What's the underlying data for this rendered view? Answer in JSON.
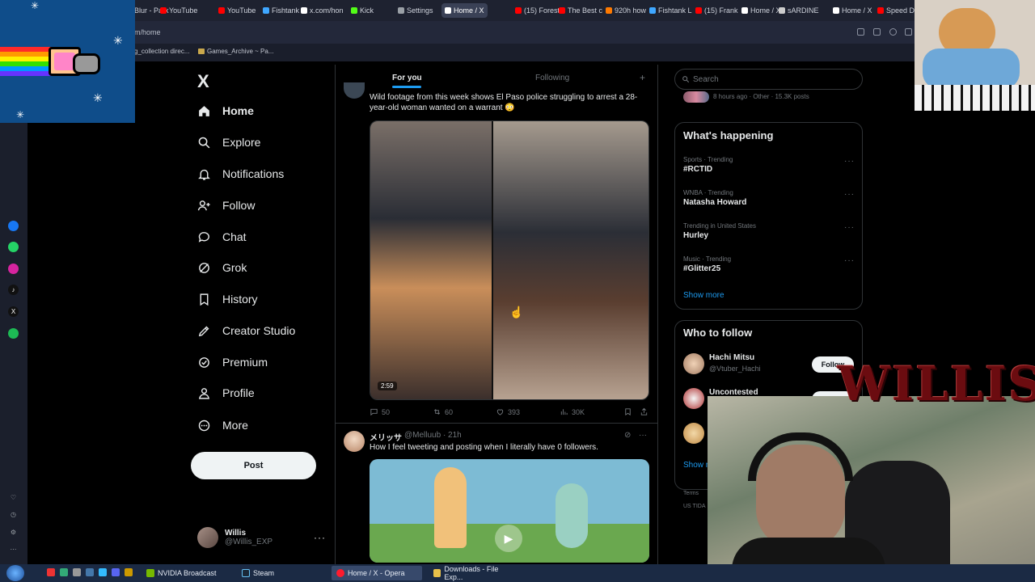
{
  "browser": {
    "tabs": [
      {
        "label": "Blur - Park",
        "color": "#8a8f99"
      },
      {
        "label": "YouTube",
        "color": "#ff0000"
      },
      {
        "label": "YouTube",
        "color": "#ff0000"
      },
      {
        "label": "Fishtank L",
        "color": "#3fa7ff"
      },
      {
        "label": "x.com/hon",
        "color": "#ffffff"
      },
      {
        "label": "Kick",
        "color": "#53fc18"
      },
      {
        "label": "Settings",
        "color": "#9aa0a6"
      },
      {
        "label": "Home / X",
        "color": "#ffffff"
      },
      {
        "label": "(15) Forest",
        "color": "#ff0000"
      },
      {
        "label": "The Best c",
        "color": "#ff0000"
      },
      {
        "label": "920h how",
        "color": "#ff7a00"
      },
      {
        "label": "Fishtank L",
        "color": "#3fa7ff"
      },
      {
        "label": "(15) Frank",
        "color": "#ff0000"
      },
      {
        "label": "Home / X",
        "color": "#ffffff"
      },
      {
        "label": "sARDINE",
        "color": "#cccccc"
      },
      {
        "label": "Home / X",
        "color": "#ffffff"
      },
      {
        "label": "Speed D",
        "color": "#ff0000"
      }
    ],
    "url": "m/home",
    "bookmarks": [
      "g_collection direc...",
      "Games_Archive ~ Pa..."
    ]
  },
  "x": {
    "logo": "X",
    "nav": [
      "Home",
      "Explore",
      "Notifications",
      "Follow",
      "Chat",
      "Grok",
      "History",
      "Creator Studio",
      "Premium",
      "Profile",
      "More"
    ],
    "post_label": "Post",
    "account": {
      "name": "Willis",
      "handle": "@Willis_EXP"
    }
  },
  "feed": {
    "tab_for_you": "For you",
    "tab_following": "Following",
    "tweet1": {
      "text": "Wild footage from this week shows El Paso police struggling to arrest a 28-year-old woman wanted on a warrant 😳",
      "duration": "2:59",
      "replies": "50",
      "reposts": "60",
      "likes": "393",
      "views": "30K"
    },
    "tweet2": {
      "name": "メリッサ",
      "handle": "@Melluub · 21h",
      "text": "How I feel tweeting and posting when I literally have 0 followers."
    }
  },
  "sidebar": {
    "search_placeholder": "Search",
    "top_meta": "8 hours ago · Other · 15.3K posts",
    "happening_title": "What's happening",
    "trends": [
      {
        "meta": "Sports · Trending",
        "name": "#RCTID"
      },
      {
        "meta": "WNBA · Trending",
        "name": "Natasha Howard"
      },
      {
        "meta": "Trending in United States",
        "name": "Hurley"
      },
      {
        "meta": "Music · Trending",
        "name": "#Glitter25"
      }
    ],
    "show_more": "Show more",
    "who_title": "Who to follow",
    "who": [
      {
        "name": "Hachi Mitsu",
        "handle": "@Vtuber_Hachi",
        "follow": "Follow"
      },
      {
        "name": "Uncontested",
        "handle": "",
        "follow": "Follow"
      }
    ],
    "show_more_2": "Show m",
    "terms": "Terms",
    "terms_2": "US TIDA"
  },
  "overlay": {
    "stream_name": "WILLIS"
  },
  "taskbar": {
    "items": [
      "NVIDIA Broadcast",
      "Steam",
      "Home / X - Opera",
      "Downloads - File Exp..."
    ]
  }
}
